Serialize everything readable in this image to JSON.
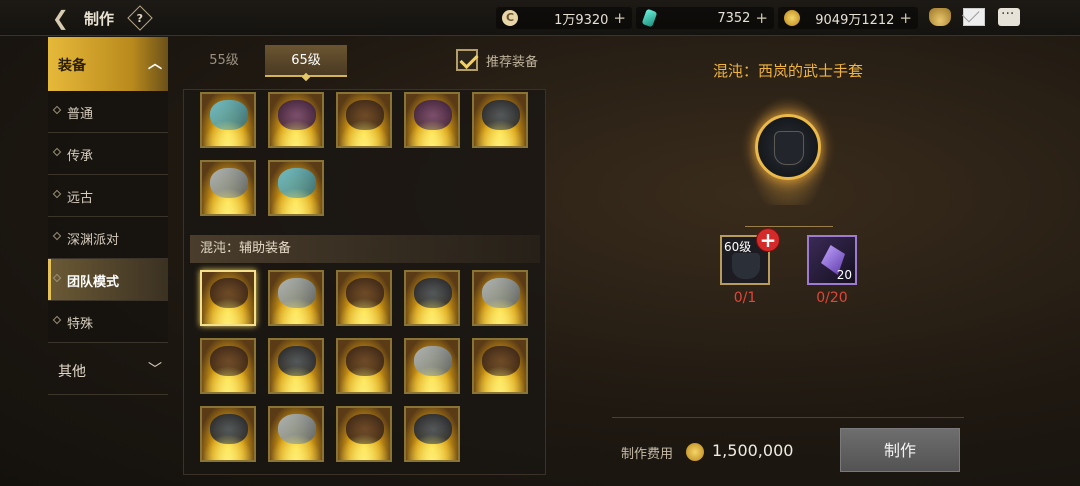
{
  "header": {
    "title": "制作",
    "help_label": "?"
  },
  "currencies": {
    "gold_c": "1万9320",
    "gem": "7352",
    "coin": "9049万1212",
    "plus": "+"
  },
  "sidebar": {
    "category": "装备",
    "items": [
      {
        "label": "普通"
      },
      {
        "label": "传承"
      },
      {
        "label": "远古"
      },
      {
        "label": "深渊派对"
      },
      {
        "label": "团队模式",
        "active": true
      },
      {
        "label": "特殊"
      }
    ],
    "other": "其他"
  },
  "tabs": {
    "lv55": "55级",
    "lv65": "65级",
    "active": "65级"
  },
  "recommend": {
    "label": "推荐装备",
    "checked": true
  },
  "grid": {
    "section_title": "混沌：辅助装备",
    "selected_index": 0
  },
  "detail": {
    "title": "混沌：西岚的武士手套",
    "materials": [
      {
        "level": "60级",
        "progress": "0/1"
      },
      {
        "count": "20",
        "progress": "0/20"
      }
    ],
    "cost_label": "制作费用",
    "cost_value": "1,500,000",
    "make_button": "制作"
  },
  "colors": {
    "accent_gold": "#e6b93a",
    "title_orange": "#f0b43e",
    "progress_red": "#e0463a"
  }
}
